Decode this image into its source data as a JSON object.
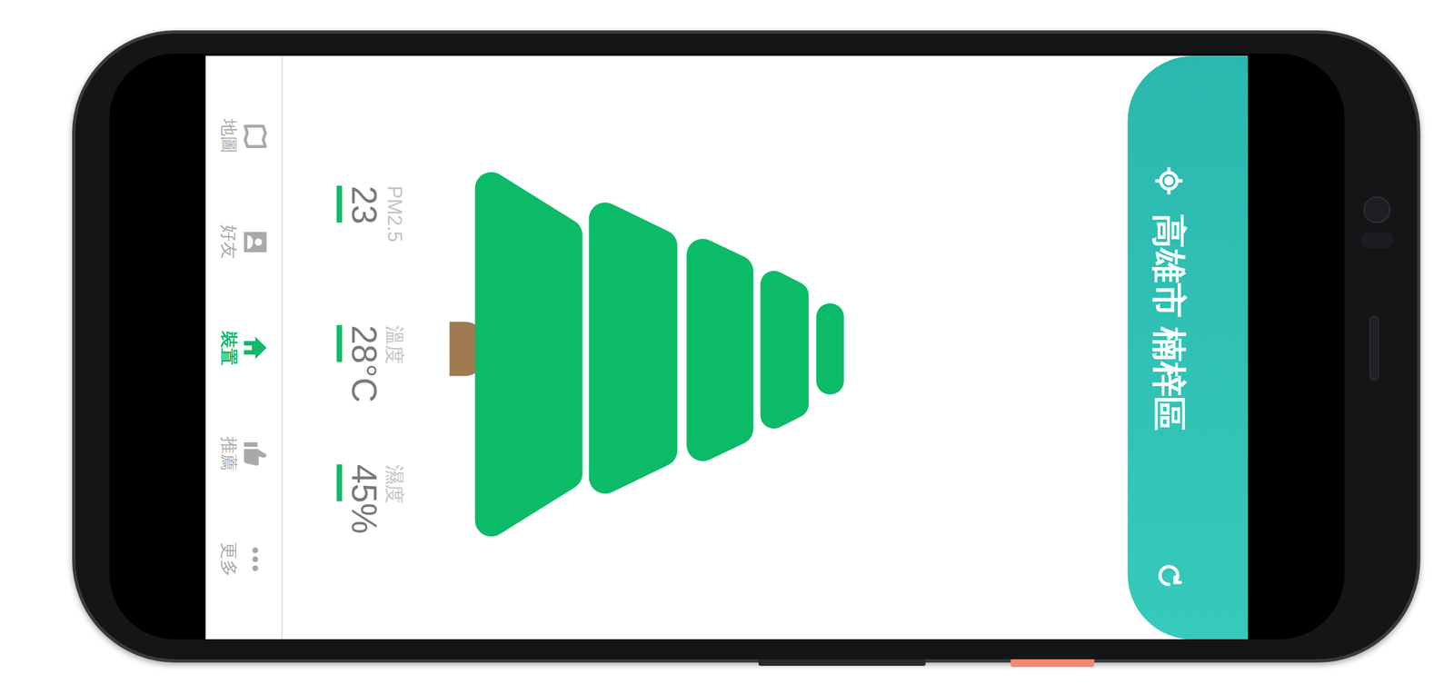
{
  "header": {
    "location": "高雄市 楠梓區"
  },
  "stats": [
    {
      "label": "PM2.5",
      "value": "23"
    },
    {
      "label": "溫度",
      "value": "28°C"
    },
    {
      "label": "濕度",
      "value": "45%"
    }
  ],
  "nav": [
    {
      "label": "地圖",
      "selected": false
    },
    {
      "label": "好友",
      "selected": false
    },
    {
      "label": "裝置",
      "selected": true
    },
    {
      "label": "推薦",
      "selected": false
    },
    {
      "label": "更多",
      "selected": false
    }
  ]
}
